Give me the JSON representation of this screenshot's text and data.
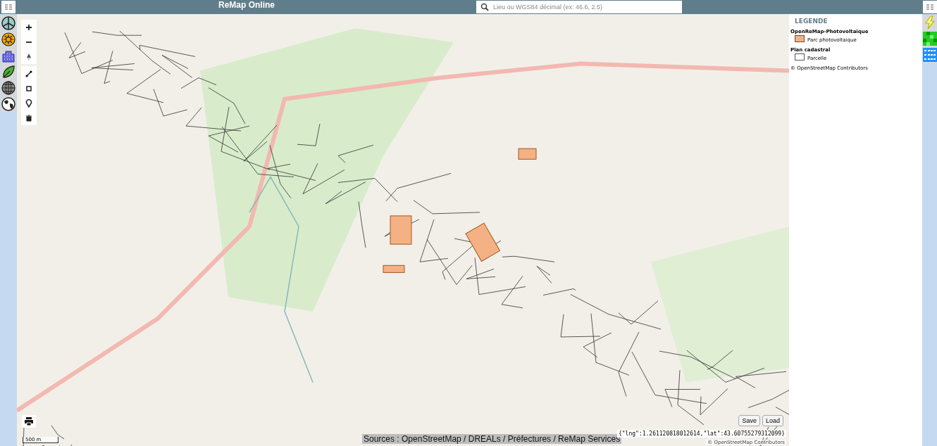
{
  "header": {
    "title": "ReMap Online",
    "search": {
      "placeholder": "Lieu ou WGS84 décimal (ex: 46.6, 2.5)"
    }
  },
  "legend": {
    "title": "LEGENDE",
    "groups": [
      {
        "name": "OpenReMap-Photovoltaique",
        "items": [
          {
            "label": "Parc photovoltaique",
            "color": "#f4b183"
          }
        ]
      },
      {
        "name": "Plan cadastral",
        "items": [
          {
            "label": "Parcelle",
            "color": "#ffffff"
          }
        ]
      }
    ],
    "attribution": "© OpenStreetMap Contributors"
  },
  "map": {
    "scale": "500 m",
    "buttons": [
      "Save",
      "Load"
    ],
    "coordinates": "{\"lng\":1.261120818012614,\"lat\":43.60755279312099}",
    "attribution": "© OpenStreetMap Contributors",
    "sources": "Sources : OpenStreetMap / DREALs / Préfectures / ReMap Services"
  }
}
